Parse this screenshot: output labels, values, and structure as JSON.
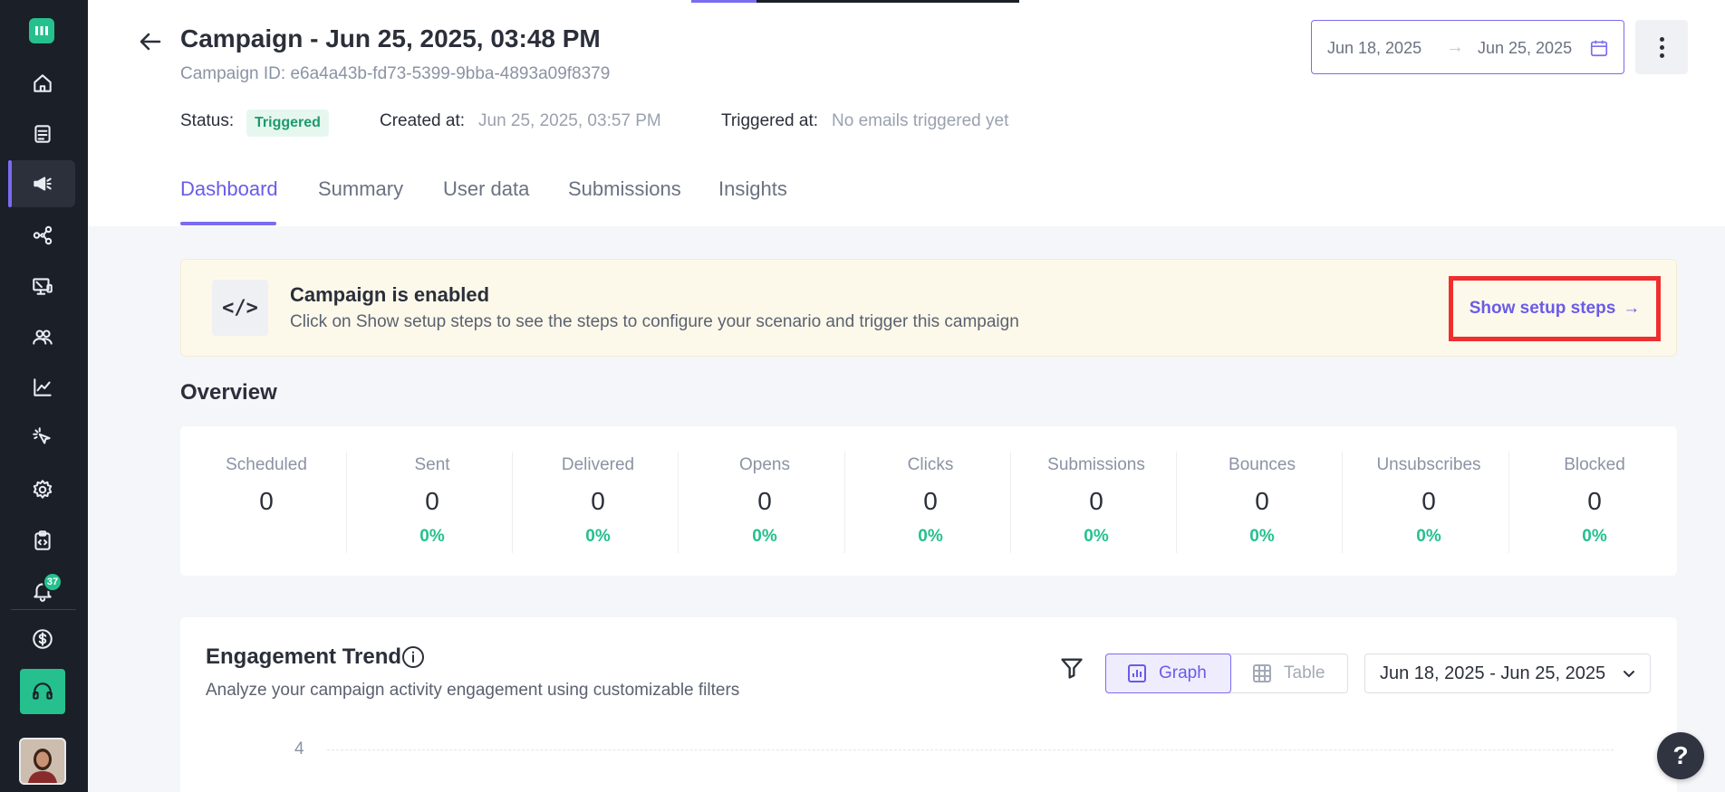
{
  "sidebar": {
    "items": [
      {
        "icon": "home-icon"
      },
      {
        "icon": "templates-icon"
      },
      {
        "icon": "megaphone-icon",
        "active": true
      },
      {
        "icon": "workflow-icon"
      },
      {
        "icon": "screen-icon"
      },
      {
        "icon": "users-icon"
      },
      {
        "icon": "analytics-icon"
      },
      {
        "icon": "click-icon"
      },
      {
        "icon": "settings-icon"
      },
      {
        "icon": "code-clipboard-icon"
      },
      {
        "icon": "bell-icon"
      }
    ],
    "notification_count": "37",
    "bottom": [
      {
        "icon": "billing-icon"
      },
      {
        "icon": "headset-icon"
      },
      {
        "icon": "avatar"
      }
    ]
  },
  "header": {
    "title": "Campaign - Jun 25, 2025, 03:48 PM",
    "campaign_id": "Campaign ID: e6a4a43b-fd73-5399-9bba-4893a09f8379",
    "status_label": "Status:",
    "status_value": "Triggered",
    "created_label": "Created at:",
    "created_value": "Jun 25, 2025, 03:57 PM",
    "triggered_label": "Triggered at:",
    "triggered_value": "No emails triggered yet",
    "date_start": "Jun 18, 2025",
    "date_end": "Jun 25, 2025",
    "date_arrow": "→"
  },
  "tabs": [
    {
      "label": "Dashboard",
      "active": true
    },
    {
      "label": "Summary"
    },
    {
      "label": "User data"
    },
    {
      "label": "Submissions"
    },
    {
      "label": "Insights"
    }
  ],
  "banner": {
    "icon_text": "</>",
    "title": "Campaign is enabled",
    "description": "Click on Show setup steps to see the steps to configure your scenario and trigger this campaign",
    "button": "Show setup steps",
    "button_arrow": "→"
  },
  "overview": {
    "title": "Overview",
    "stats": [
      {
        "label": "Scheduled",
        "value": "0",
        "percent": ""
      },
      {
        "label": "Sent",
        "value": "0",
        "percent": "0%"
      },
      {
        "label": "Delivered",
        "value": "0",
        "percent": "0%"
      },
      {
        "label": "Opens",
        "value": "0",
        "percent": "0%"
      },
      {
        "label": "Clicks",
        "value": "0",
        "percent": "0%"
      },
      {
        "label": "Submissions",
        "value": "0",
        "percent": "0%"
      },
      {
        "label": "Bounces",
        "value": "0",
        "percent": "0%"
      },
      {
        "label": "Unsubscribes",
        "value": "0",
        "percent": "0%"
      },
      {
        "label": "Blocked",
        "value": "0",
        "percent": "0%"
      }
    ]
  },
  "engagement": {
    "title": "Engagement Trend",
    "description": "Analyze your campaign activity engagement using customizable filters",
    "view_graph": "Graph",
    "view_table": "Table",
    "range": "Jun 18, 2025 - Jun 25, 2025",
    "y_tick": "4"
  },
  "help": {
    "label": "?"
  },
  "colors": {
    "accent": "#7a6cf0",
    "success": "#25c08e",
    "sidebar": "#1b1f27",
    "highlight": "#ef2e2e"
  }
}
